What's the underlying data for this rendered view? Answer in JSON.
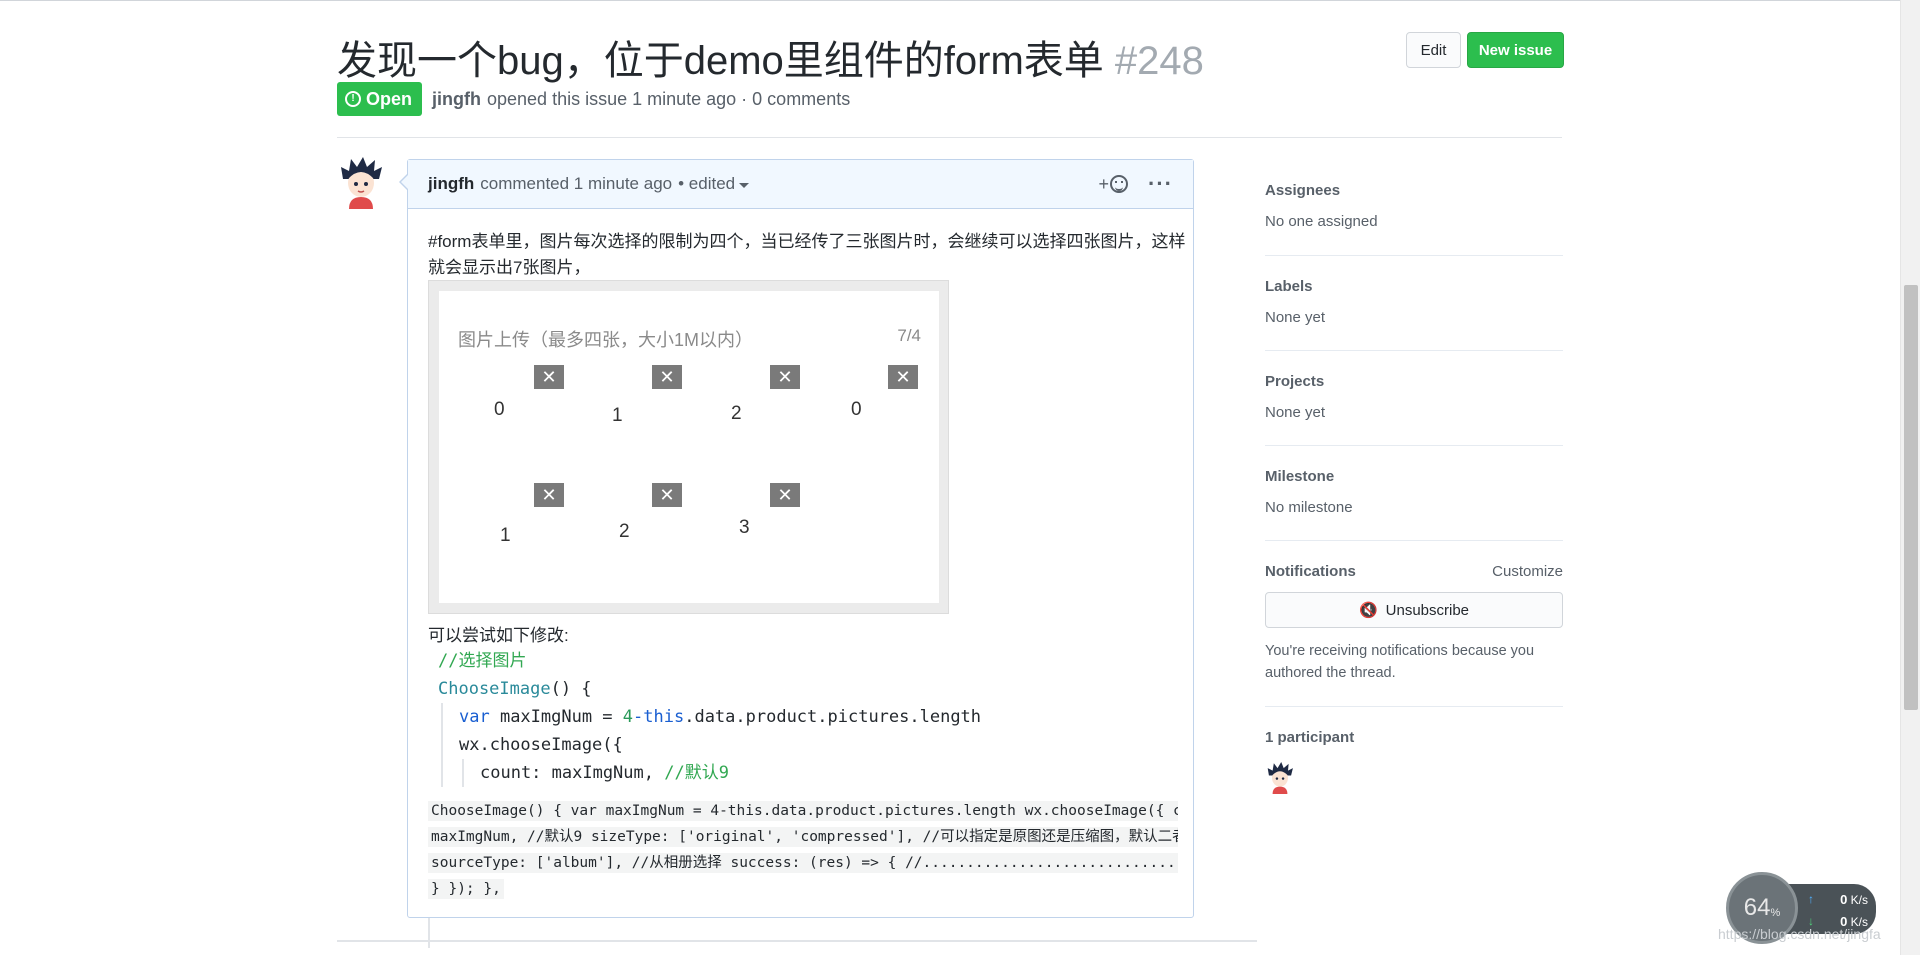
{
  "issue": {
    "title": "发现一个bug，位于demo里组件的form表单",
    "number": "#248",
    "state": "Open",
    "author": "jingfh",
    "meta": "opened this issue 1 minute ago · 0 comments",
    "edit_label": "Edit",
    "new_issue_label": "New issue"
  },
  "comment": {
    "author": "jingfh",
    "action": "commented 1 minute ago",
    "edited": "• edited",
    "reaction_label": "+",
    "more_label": "···",
    "paragraph": "#form表单里，图片每次选择的限制为四个，当已经传了三张图片时，会继续可以选择四张图片，这样就会显示出7张图片，",
    "screenshot": {
      "title": "图片上传（最多四张，大小1M以内）",
      "count": "7/4",
      "close_glyph": "✕",
      "row1": [
        "0",
        "1",
        "2",
        "0"
      ],
      "row2": [
        "1",
        "2",
        "3"
      ]
    },
    "after_text": "可以尝试如下修改:",
    "code_snip": {
      "line1": "//选择图片",
      "line2_func": "ChooseImage",
      "line2_rest": "() {",
      "line3_kw": "var",
      "line3_a": " maxImgNum = ",
      "line3_num": "4",
      "line3_kw2": "-this",
      "line3_b": ".data.product.pictures.length",
      "line4": "wx.chooseImage({",
      "line5_a": "count: maxImgNum, ",
      "line5_comment": "//默认9"
    },
    "code_wall": [
      "ChooseImage() { var maxImgNum = 4-this.data.product.pictures.length wx.chooseImage({ count:",
      "maxImgNum, //默认9 sizeType: ['original', 'compressed'], //可以指定是原图还是压缩图，默认二者都有",
      "sourceType: ['album'], //从相册选择 success: (res) => { //........................................",
      "} }); },"
    ]
  },
  "sidebar": {
    "assignees_heading": "Assignees",
    "assignees_value": "No one assigned",
    "labels_heading": "Labels",
    "labels_value": "None yet",
    "projects_heading": "Projects",
    "projects_value": "None yet",
    "milestone_heading": "Milestone",
    "milestone_value": "No milestone",
    "notifications_heading": "Notifications",
    "customize_label": "Customize",
    "unsubscribe_label": "Unsubscribe",
    "notice": "You're receiving notifications because you authored the thread.",
    "participants_heading": "1 participant"
  },
  "widget": {
    "percent": "64",
    "percent_unit": "%",
    "up_arrow": "↑",
    "up_value": "0",
    "up_unit": "K/s",
    "down_arrow": "↓",
    "down_value": "0",
    "down_unit": "K/s",
    "watermark": "https://blog.csdn.net/jingfa"
  },
  "colors": {
    "green": "#2cbe4e",
    "comment_border": "#c0d3eb",
    "comment_header_bg": "#f1f8ff"
  }
}
